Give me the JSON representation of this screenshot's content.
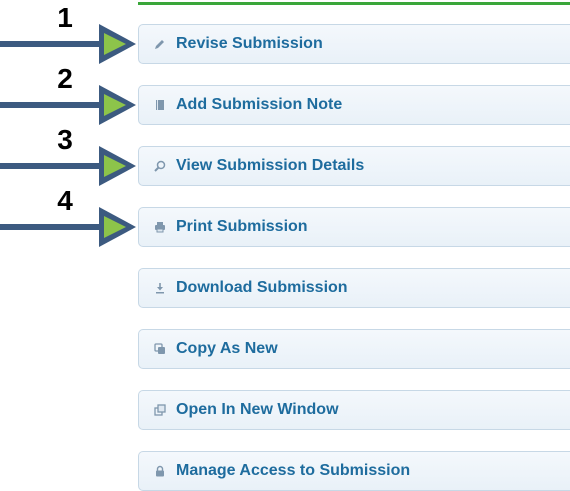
{
  "colors": {
    "accent_rule": "#3aa63a",
    "link_text": "#1e6c9e",
    "callout_arrow_shaft": "#3c5a80",
    "callout_arrow_head": "#8dc44a"
  },
  "callouts": [
    {
      "number": "1"
    },
    {
      "number": "2"
    },
    {
      "number": "3"
    },
    {
      "number": "4"
    }
  ],
  "menu": {
    "items": [
      {
        "label": "Revise Submission",
        "icon": "pencil-icon"
      },
      {
        "label": "Add Submission Note",
        "icon": "note-icon"
      },
      {
        "label": "View Submission Details",
        "icon": "magnifier-icon"
      },
      {
        "label": "Print Submission",
        "icon": "printer-icon"
      },
      {
        "label": "Download Submission",
        "icon": "download-icon"
      },
      {
        "label": "Copy As New",
        "icon": "copy-icon"
      },
      {
        "label": "Open In New Window",
        "icon": "new-window-icon"
      },
      {
        "label": "Manage Access to Submission",
        "icon": "lock-icon"
      }
    ]
  }
}
